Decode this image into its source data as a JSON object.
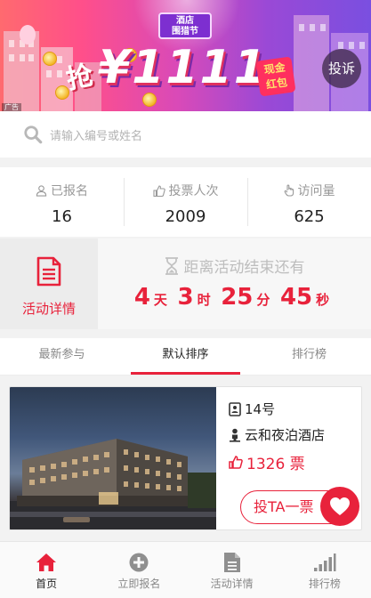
{
  "banner": {
    "festival_label": "酒店\n围猎节",
    "headline": "1111",
    "currency": "¥",
    "grab": "抢",
    "hongbao": "现金\n红包",
    "complain_label": "投诉",
    "ad_label": "广告"
  },
  "search": {
    "placeholder": "请输入编号或姓名"
  },
  "stats": [
    {
      "label": "已报名",
      "value": "16",
      "icon": "person-icon"
    },
    {
      "label": "投票人次",
      "value": "2009",
      "icon": "thumbs-up-icon"
    },
    {
      "label": "访问量",
      "value": "625",
      "icon": "pointer-hand-icon"
    }
  ],
  "countdown": {
    "detail_label": "活动详情",
    "title": "距离活动结束还有",
    "days": "4",
    "days_unit": "天",
    "hours": "3",
    "hours_unit": "时",
    "minutes": "25",
    "minutes_unit": "分",
    "seconds": "45",
    "seconds_unit": "秒"
  },
  "tabs": [
    {
      "label": "最新参与",
      "active": false
    },
    {
      "label": "默认排序",
      "active": true
    },
    {
      "label": "排行榜",
      "active": false
    }
  ],
  "entry": {
    "number": "14号",
    "name": "云和夜泊酒店",
    "votes": "1326 票",
    "vote_button": "投TA一票"
  },
  "nav": [
    {
      "label": "首页",
      "active": true
    },
    {
      "label": "立即报名",
      "active": false
    },
    {
      "label": "活动详情",
      "active": false
    },
    {
      "label": "排行榜",
      "active": false
    }
  ],
  "colors": {
    "accent": "#e8223b",
    "muted": "#999999"
  }
}
